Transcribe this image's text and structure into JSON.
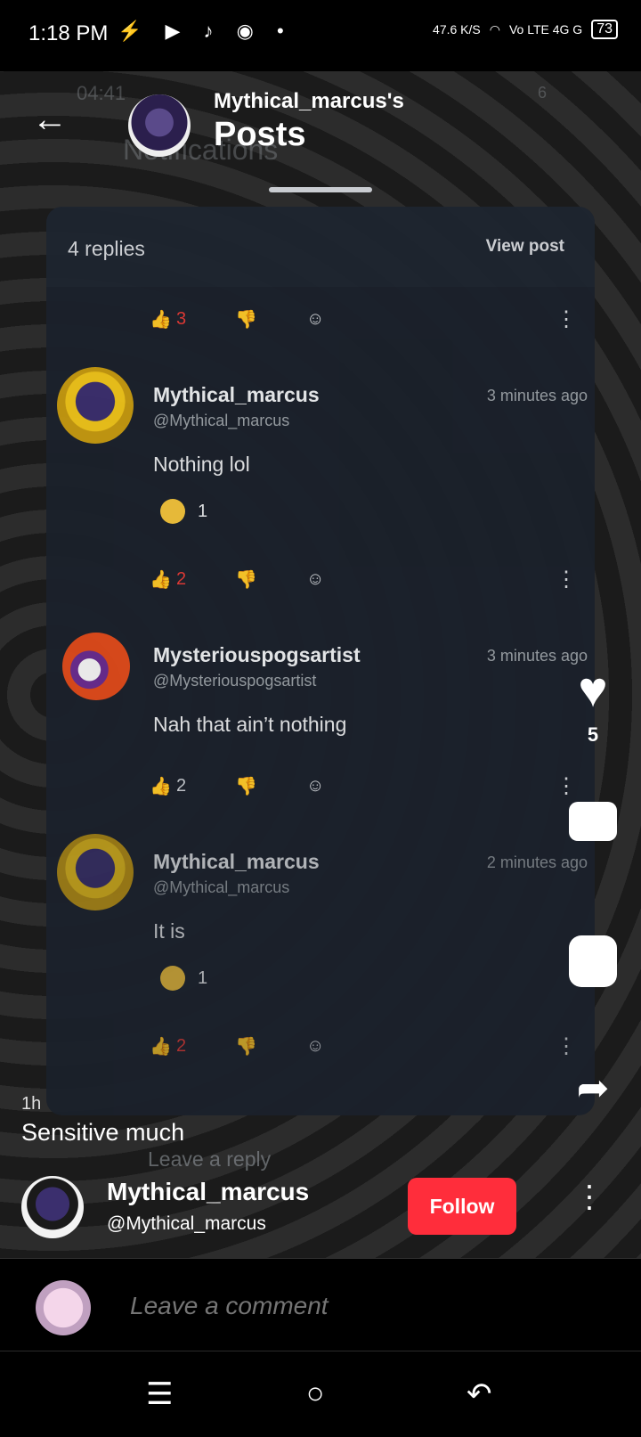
{
  "status_bar": {
    "time": "1:18 PM",
    "left_icons": "⚡ ▶ ♪ ◉ •",
    "net_speed": "47.6 K/S",
    "carrier_icons": "Vo LTE 4G G",
    "battery": "73"
  },
  "header": {
    "title_top": "Mythical_marcus's",
    "title": "Posts",
    "ghost_time": "04:41",
    "ghost_title": "Notifications",
    "ghost_badge": "6"
  },
  "panel": {
    "replies_label": "4 replies",
    "view_post_label": "View post",
    "top_actions": {
      "upvotes": "3"
    },
    "comments": [
      {
        "name": "Mythical_marcus",
        "handle": "@Mythical_marcus",
        "time": "3 minutes ago",
        "text": "Nothing lol",
        "reaction_count": "1",
        "upvotes": "2"
      },
      {
        "name": "Mysteriouspogsartist",
        "handle": "@Mysteriouspogsartist",
        "time": "3 minutes ago",
        "text": "Nah that ain’t nothing",
        "reaction_count": "",
        "upvotes": "2"
      },
      {
        "name": "Mythical_marcus",
        "handle": "@Mythical_marcus",
        "time": "2 minutes ago",
        "text": "It is",
        "reaction_count": "1",
        "upvotes": "2"
      }
    ],
    "reply_placeholder": "Leave a reply"
  },
  "right_actions": {
    "like_count": "5"
  },
  "post": {
    "time_ago": "1h",
    "caption": "Sensitive much",
    "author_name": "Mythical_marcus",
    "author_handle": "@Mythical_marcus",
    "follow_label": "Follow"
  },
  "comment_bar": {
    "placeholder": "Leave a comment"
  },
  "colors": {
    "accent": "#ff2d3b",
    "upvote": "#e53935",
    "panel": "#1b212b"
  },
  "icons": [
    "back-arrow-icon",
    "heart-icon",
    "comment-bubble-icon",
    "repost-icon",
    "share-icon",
    "thumbs-up-icon",
    "thumbs-down-icon",
    "add-reaction-icon",
    "more-vertical-icon"
  ]
}
